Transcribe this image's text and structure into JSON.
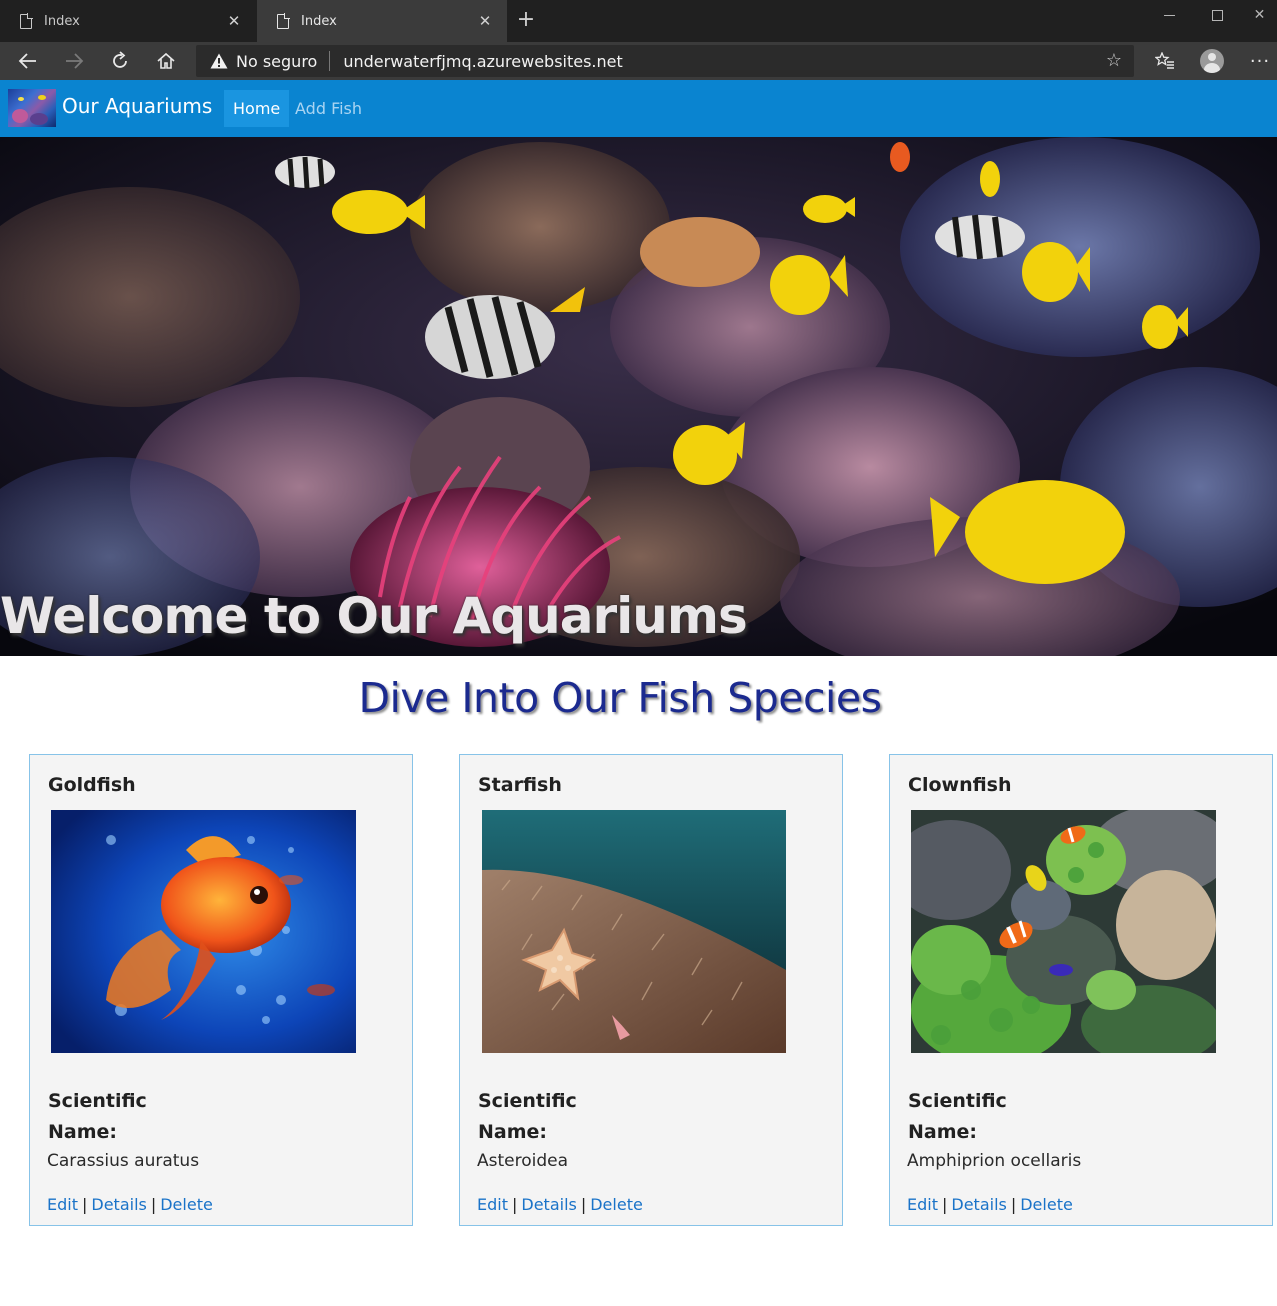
{
  "browser": {
    "tabs": [
      {
        "label": "Index",
        "active": false
      },
      {
        "label": "Index",
        "active": true
      }
    ],
    "security_text": "No seguro",
    "url": "underwaterfjmq.azurewebsites.net",
    "icons": [
      "back-arrow-icon",
      "forward-arrow-icon",
      "reload-icon",
      "home-icon",
      "warning-icon",
      "star-icon",
      "favorites-icon",
      "profile-icon",
      "more-icon"
    ]
  },
  "navbar": {
    "brand": "Our Aquariums",
    "links": [
      {
        "label": "Home",
        "active": true
      },
      {
        "label": "Add Fish",
        "active": false
      }
    ],
    "color": "#0a84d0"
  },
  "hero": {
    "title": "Welcome to Our Aquariums"
  },
  "section": {
    "title": "Dive Into Our Fish Species",
    "title_color": "#1b2a8f"
  },
  "labels": {
    "scientific_name": "Scientific Name:",
    "edit": "Edit",
    "details": "Details",
    "delete": "Delete",
    "separator": "|"
  },
  "fish": [
    {
      "name": "Goldfish",
      "scientific_name": "Carassius auratus",
      "image": "goldfish-photo"
    },
    {
      "name": "Starfish",
      "scientific_name": "Asteroidea",
      "image": "starfish-photo"
    },
    {
      "name": "Clownfish",
      "scientific_name": "Amphiprion ocellaris",
      "image": "clownfish-photo"
    }
  ],
  "colors": {
    "link": "#1a73c8",
    "card_border": "#87c3e8",
    "card_bg": "#f4f4f4"
  }
}
